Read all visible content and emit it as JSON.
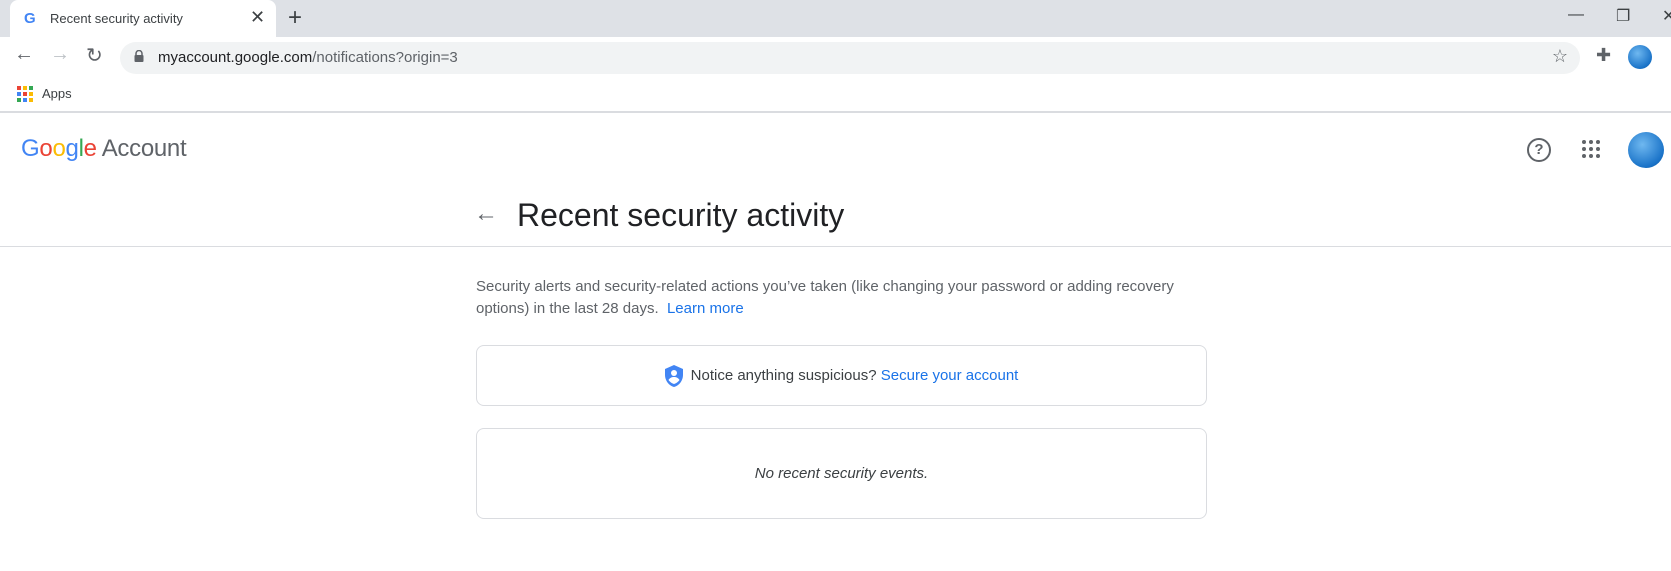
{
  "browser": {
    "tab_title": "Recent security activity",
    "url_host": "myaccount.google.com",
    "url_path": "/notifications?origin=3",
    "bookmarks": [
      {
        "label": "Apps"
      }
    ]
  },
  "header": {
    "logo_google": "Google",
    "logo_account": "Account"
  },
  "page": {
    "title": "Recent security activity",
    "description": "Security alerts and security-related actions you’ve taken (like changing your password or adding recovery options) in the last 28 days.",
    "learn_more": "Learn more",
    "notice_text": "Notice anything suspicious?",
    "secure_link": "Secure your account",
    "empty_text": "No recent security events."
  },
  "colors": {
    "accent": "#1a73e8",
    "shield": "#4285f4"
  }
}
